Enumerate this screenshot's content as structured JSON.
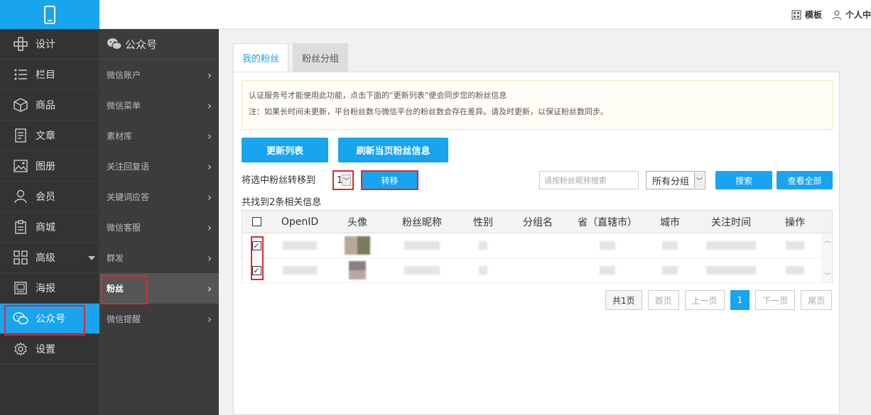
{
  "topbar": {
    "template_label": "模板",
    "personal_label": "个人中"
  },
  "sidebar": {
    "items": [
      {
        "label": "设计",
        "icon": "design-icon"
      },
      {
        "label": "栏目",
        "icon": "list-icon"
      },
      {
        "label": "商品",
        "icon": "box-icon"
      },
      {
        "label": "文章",
        "icon": "article-icon"
      },
      {
        "label": "图册",
        "icon": "gallery-icon"
      },
      {
        "label": "会员",
        "icon": "user-icon"
      },
      {
        "label": "商城",
        "icon": "clipboard-icon"
      },
      {
        "label": "高级",
        "icon": "grid-icon"
      },
      {
        "label": "海报",
        "icon": "poster-icon"
      },
      {
        "label": "公众号",
        "icon": "wechat-icon"
      },
      {
        "label": "设置",
        "icon": "gear-icon"
      }
    ]
  },
  "subnav": {
    "title": "公众号",
    "items": [
      {
        "label": "微信账户"
      },
      {
        "label": "微信菜单"
      },
      {
        "label": "素材库"
      },
      {
        "label": "关注回复语"
      },
      {
        "label": "关键词应答"
      },
      {
        "label": "微信客服"
      },
      {
        "label": "群发"
      },
      {
        "label": "粉丝"
      },
      {
        "label": "微信提醒"
      }
    ]
  },
  "tabs": [
    {
      "label": "我的粉丝"
    },
    {
      "label": "粉丝分组"
    }
  ],
  "notice": {
    "line1": "认证服务号才能使用此功能，点击下面的“更新列表”便会同步您的粉丝信息",
    "line2": "注：如果长时间未更新，平台粉丝数与微信平台的粉丝数会存在差异。请及时更新，以保证粉丝数同步。"
  },
  "actions": {
    "update_list": "更新列表",
    "refresh_page": "刷新当页粉丝信息",
    "move_label": "将选中粉丝转移到",
    "move_target": "1",
    "move_button": "转移",
    "search_placeholder": "请按粉丝昵称搜索",
    "group_filter": "所有分组",
    "search_button": "搜索",
    "view_all_button": "查看全部"
  },
  "result_text": "共找到2条相关信息",
  "table": {
    "headers": [
      "OpenID",
      "头像",
      "粉丝昵称",
      "性别",
      "分组名",
      "省（直辖市）",
      "城市",
      "关注时间",
      "操作"
    ]
  },
  "pager": {
    "total": "共1页",
    "first": "首页",
    "prev": "上一页",
    "current": "1",
    "next": "下一页",
    "last": "尾页"
  },
  "colors": {
    "accent": "#18a4ee",
    "highlight": "#e0282e",
    "sidebar_bg": "#333333"
  }
}
